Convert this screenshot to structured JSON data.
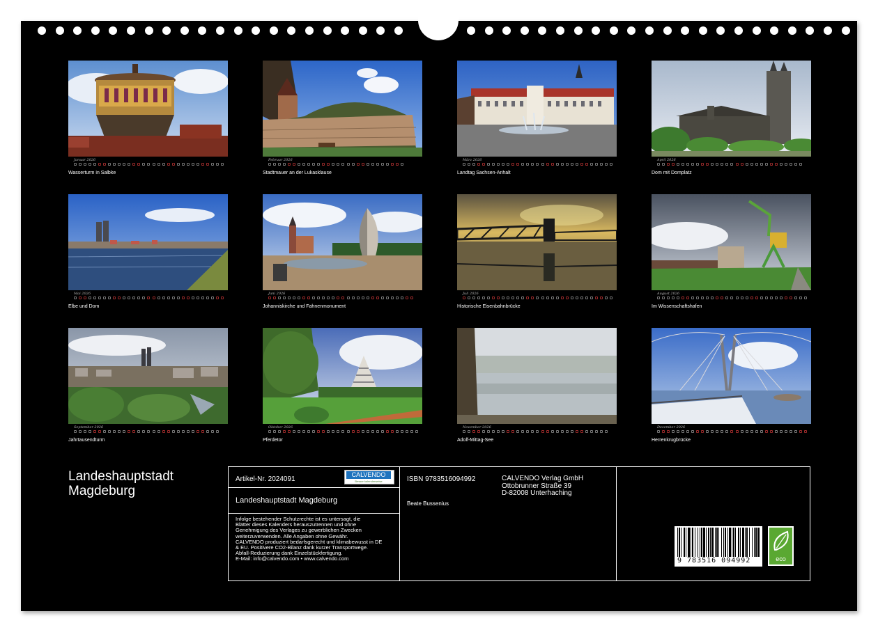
{
  "months": [
    {
      "caption": "Wasserturm in Salbke",
      "month_label": "Januar 2026",
      "days": 31
    },
    {
      "caption": "Stadtmauer an der Lukasklause",
      "month_label": "Februar 2026",
      "days": 28
    },
    {
      "caption": "Landtag Sachsen-Anhalt",
      "month_label": "März 2026",
      "days": 31
    },
    {
      "caption": "Dom mit Domplatz",
      "month_label": "April 2026",
      "days": 30
    },
    {
      "caption": "Elbe und Dom",
      "month_label": "Mai 2026",
      "days": 31
    },
    {
      "caption": "Johanniskirche und Fahnenmonument",
      "month_label": "Juni 2026",
      "days": 30
    },
    {
      "caption": "Historische Eisenbahnbrücke",
      "month_label": "Juli 2026",
      "days": 31
    },
    {
      "caption": "Im Wissenschaftshafen",
      "month_label": "August 2026",
      "days": 31
    },
    {
      "caption": "Jahrtausendturm",
      "month_label": "September 2026",
      "days": 30
    },
    {
      "caption": "Pferdetor",
      "month_label": "Oktober 2026",
      "days": 31
    },
    {
      "caption": "Adolf-Mittag-See",
      "month_label": "November 2026",
      "days": 30
    },
    {
      "caption": "Herrenkrugbrücke",
      "month_label": "Dezember 2026",
      "days": 31
    }
  ],
  "title_line1": "Landeshauptstadt",
  "title_line2": "Magdeburg",
  "info": {
    "article": "Artikel-Nr. 2024091",
    "logo_text": "CALVENDO",
    "logo_sub": "Besser kalenderweise",
    "calendar_title": "Landeshauptstadt Magdeburg",
    "legal": [
      "Infolge bestehender Schutzrechte ist es untersagt, die",
      "Blätter dieses Kalenders herauszutrennen und ohne",
      "Genehmigung des Verlages zu gewerblichen Zwecken",
      "weiterzuverwenden. Alle Angaben ohne Gewähr.",
      "CALVENDO produziert bedarfsgerecht und klimabewusst in DE",
      "& EU. Positivere CO2-Bilanz dank kurzer Transportwege.",
      "Abfall-Reduzierung dank Einzelstückfertigung.",
      "E-Mail: info@calvendo.com • www.calvendo.com"
    ],
    "isbn": "ISBN 9783516094992",
    "author": "Beate Bussenius",
    "publisher": [
      "CALVENDO Verlag GmbH",
      "Ottobrunner Straße 39",
      "D-82008 Unterhaching"
    ],
    "barcode_number": "9 783516 094992",
    "eco_label": "eco"
  }
}
